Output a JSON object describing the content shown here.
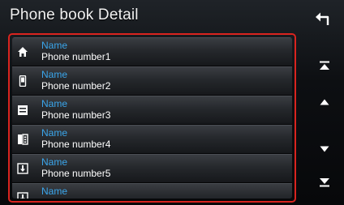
{
  "header": {
    "title": "Phone book Detail",
    "back_icon": "back-arrow-icon"
  },
  "entries": [
    {
      "name": "Name",
      "number": "Phone number1",
      "type_icon": "home-icon"
    },
    {
      "name": "Name",
      "number": "Phone number2",
      "type_icon": "mobile-phone-icon"
    },
    {
      "name": "Name",
      "number": "Phone number3",
      "type_icon": "office-icon"
    },
    {
      "name": "Name",
      "number": "Phone number4",
      "type_icon": "building-icon"
    },
    {
      "name": "Name",
      "number": "Phone number5",
      "type_icon": "other-icon"
    },
    {
      "name": "Name",
      "number": "",
      "type_icon": "other-icon"
    }
  ],
  "scroll_controls": {
    "icons": [
      "scroll-top-icon",
      "scroll-up-icon",
      "scroll-down-icon",
      "scroll-bottom-icon"
    ]
  },
  "colors": {
    "selection_border": "#d9241f",
    "name_text": "#3aa6ec",
    "number_text": "#ffffff",
    "background": "#0d0f12"
  }
}
